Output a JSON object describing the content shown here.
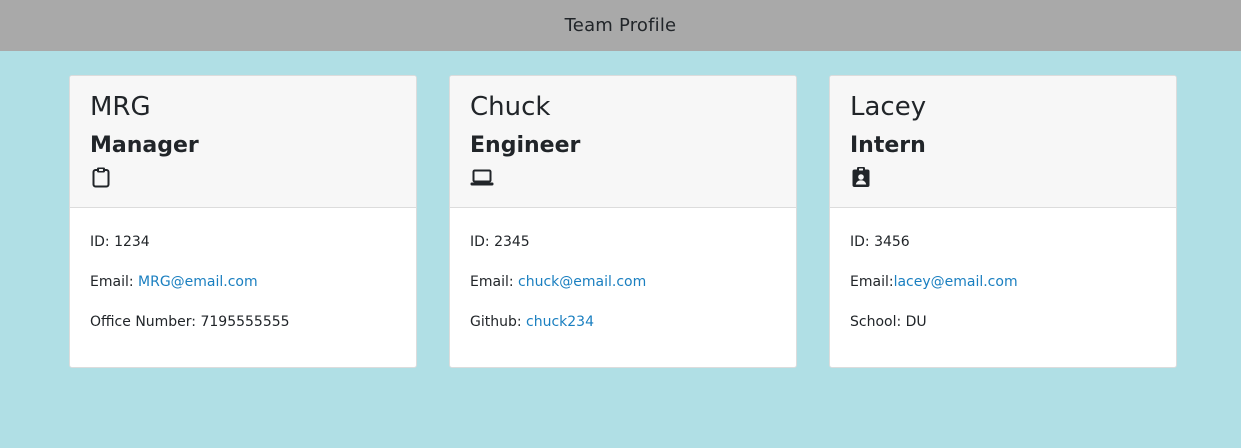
{
  "header": {
    "title": "Team Profile"
  },
  "colors": {
    "page_background": "#b0dfe5",
    "header_background": "#a9a9a9",
    "link": "#1a7fc0"
  },
  "cards": [
    {
      "name": "MRG",
      "role": "Manager",
      "icon": "clipboard-icon",
      "id_text": "ID: 1234",
      "email_label": "Email: ",
      "email": "MRG@email.com",
      "extra_label": "Office Number: ",
      "extra_value": "7195555555"
    },
    {
      "name": "Chuck",
      "role": "Engineer",
      "icon": "laptop-icon",
      "id_text": "ID: 2345",
      "email_label": "Email: ",
      "email": "chuck@email.com",
      "extra_label": "Github: ",
      "extra_value": "chuck234"
    },
    {
      "name": "Lacey",
      "role": "Intern",
      "icon": "id-badge-icon",
      "id_text": "ID: 3456",
      "email_label": "Email:",
      "email": "lacey@email.com",
      "extra_label": "School: ",
      "extra_value": "DU"
    }
  ]
}
